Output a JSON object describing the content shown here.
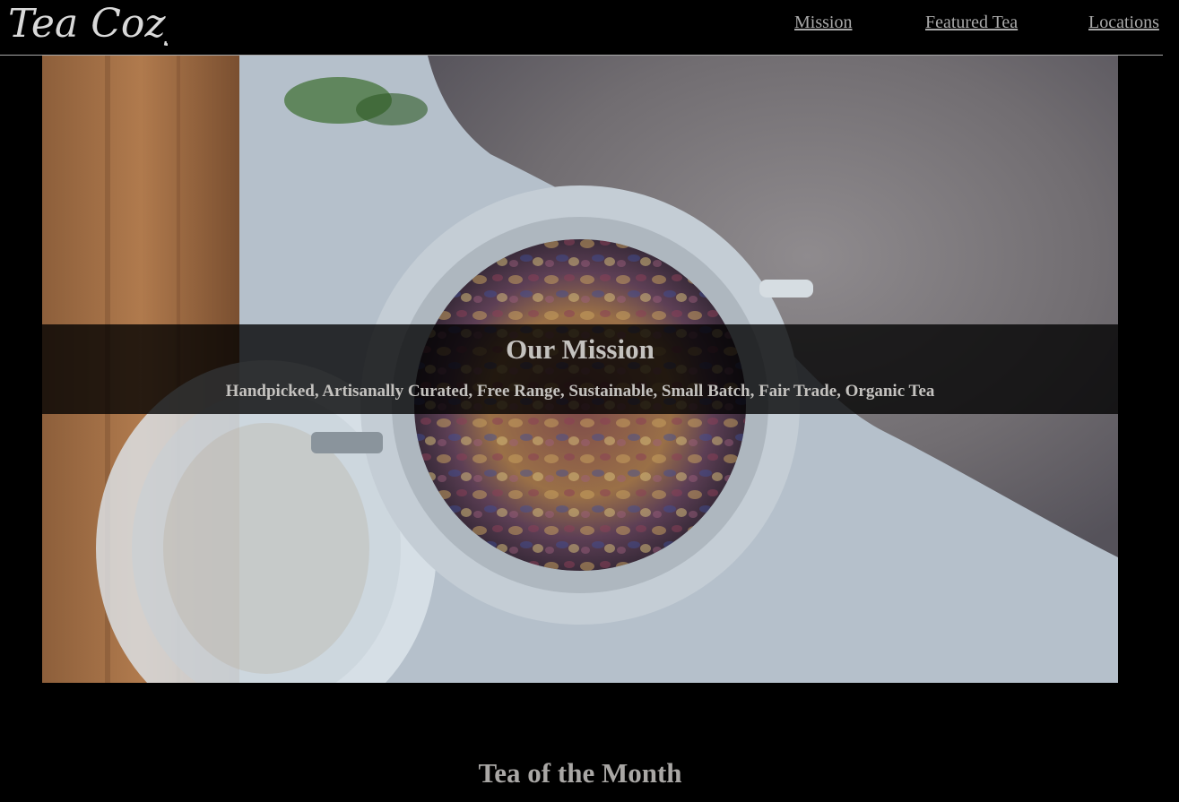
{
  "header": {
    "logo_text": "Tea Cozy",
    "nav": {
      "mission": "Mission",
      "featured": "Featured Tea",
      "locations": "Locations"
    }
  },
  "hero": {
    "image_icon": "tea-jar-photo",
    "title": "Our Mission",
    "subtitle": "Handpicked, Artisanally Curated, Free Range, Sustainable, Small Batch, Fair Trade, Organic Tea"
  },
  "featured": {
    "title": "Tea of the Month"
  },
  "colors": {
    "background": "#000000",
    "text": "#aaa9a7",
    "band": "rgba(0,0,0,0.78)"
  }
}
